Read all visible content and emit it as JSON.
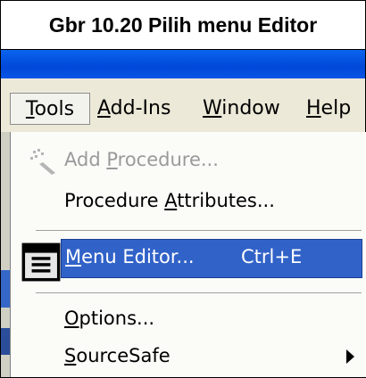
{
  "caption": "Gbr 10.20 Pilih menu Editor",
  "menubar": {
    "tools_pre": "",
    "tools_u": "T",
    "tools_post": "ools",
    "addins_u": "A",
    "addins_post": "dd-Ins",
    "window_u": "W",
    "window_post": "indow",
    "help_u": "H",
    "help_post": "elp"
  },
  "menu": {
    "add_procedure": {
      "pre": "Add ",
      "u": "P",
      "post": "rocedure..."
    },
    "procedure_attributes": {
      "pre": "Procedure ",
      "u": "A",
      "post": "ttributes..."
    },
    "menu_editor": {
      "pre": "",
      "u": "M",
      "post": "enu Editor...",
      "shortcut": "Ctrl+E"
    },
    "options": {
      "pre": "",
      "u": "O",
      "post": "ptions..."
    },
    "sourcesafe": {
      "pre": "",
      "u": "S",
      "post": "ourceSafe"
    }
  },
  "colors": {
    "highlight": "#3162c8",
    "titlebar": "#0a55e6",
    "menubar_bg": "#ece9d8"
  }
}
